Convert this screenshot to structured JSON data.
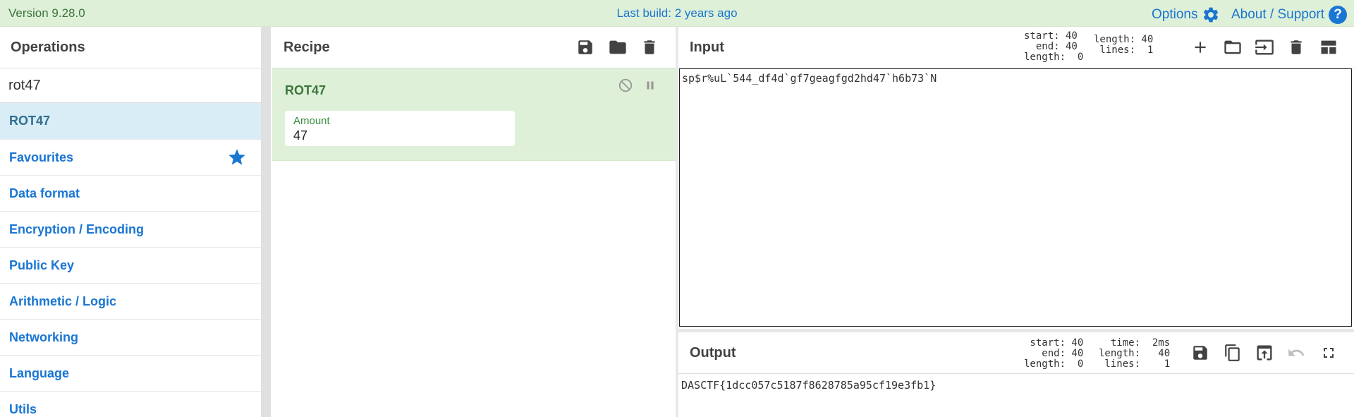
{
  "banner": {
    "version": "Version 9.28.0",
    "last_build": "Last build: 2 years ago",
    "options_label": "Options",
    "support_label": "About / Support",
    "help_glyph": "?"
  },
  "operations": {
    "title": "Operations",
    "search_value": "rot47",
    "items": [
      {
        "label": "ROT47",
        "selected": true
      },
      {
        "label": "Favourites",
        "icon": "star-icon"
      },
      {
        "label": "Data format"
      },
      {
        "label": "Encryption / Encoding"
      },
      {
        "label": "Public Key"
      },
      {
        "label": "Arithmetic / Logic"
      },
      {
        "label": "Networking"
      },
      {
        "label": "Language"
      },
      {
        "label": "Utils"
      }
    ]
  },
  "recipe": {
    "title": "Recipe",
    "toolbar_icons": [
      "save-icon",
      "folder-icon",
      "trash-icon"
    ],
    "operation": {
      "name": "ROT47",
      "arg_label": "Amount",
      "arg_value": "47"
    }
  },
  "input": {
    "title": "Input",
    "stats_left": "start: 40\n  end: 40\nlength:  0",
    "stats_right": "length: 40\n lines:  1",
    "text": "sp$r%uL`544_df4d`gf7geagfgd2hd47`h6b73`N"
  },
  "output": {
    "title": "Output",
    "stats_left": " start: 40\n   end: 40\nlength:  0",
    "stats_right": "  time:  2ms\nlength:   40\n lines:    1",
    "text": "DASCTF{1dcc057c5187f8628785a95cf19e3fb1}"
  },
  "colors": {
    "banner_bg": "#dff0d8",
    "accent": "#1976d2",
    "recipe_op_bg": "#dff0d8",
    "selected_bg": "#d9edf7"
  }
}
